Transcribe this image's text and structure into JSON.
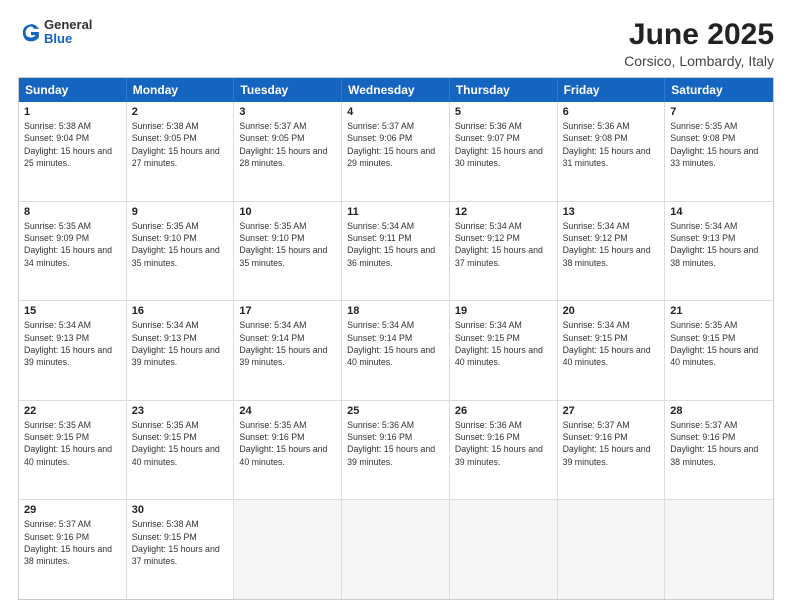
{
  "logo": {
    "general": "General",
    "blue": "Blue"
  },
  "title": "June 2025",
  "subtitle": "Corsico, Lombardy, Italy",
  "headers": [
    "Sunday",
    "Monday",
    "Tuesday",
    "Wednesday",
    "Thursday",
    "Friday",
    "Saturday"
  ],
  "rows": [
    [
      {
        "day": "1",
        "sunrise": "5:38 AM",
        "sunset": "9:04 PM",
        "daylight": "15 hours and 25 minutes."
      },
      {
        "day": "2",
        "sunrise": "5:38 AM",
        "sunset": "9:05 PM",
        "daylight": "15 hours and 27 minutes."
      },
      {
        "day": "3",
        "sunrise": "5:37 AM",
        "sunset": "9:05 PM",
        "daylight": "15 hours and 28 minutes."
      },
      {
        "day": "4",
        "sunrise": "5:37 AM",
        "sunset": "9:06 PM",
        "daylight": "15 hours and 29 minutes."
      },
      {
        "day": "5",
        "sunrise": "5:36 AM",
        "sunset": "9:07 PM",
        "daylight": "15 hours and 30 minutes."
      },
      {
        "day": "6",
        "sunrise": "5:36 AM",
        "sunset": "9:08 PM",
        "daylight": "15 hours and 31 minutes."
      },
      {
        "day": "7",
        "sunrise": "5:35 AM",
        "sunset": "9:08 PM",
        "daylight": "15 hours and 33 minutes."
      }
    ],
    [
      {
        "day": "8",
        "sunrise": "5:35 AM",
        "sunset": "9:09 PM",
        "daylight": "15 hours and 34 minutes."
      },
      {
        "day": "9",
        "sunrise": "5:35 AM",
        "sunset": "9:10 PM",
        "daylight": "15 hours and 35 minutes."
      },
      {
        "day": "10",
        "sunrise": "5:35 AM",
        "sunset": "9:10 PM",
        "daylight": "15 hours and 35 minutes."
      },
      {
        "day": "11",
        "sunrise": "5:34 AM",
        "sunset": "9:11 PM",
        "daylight": "15 hours and 36 minutes."
      },
      {
        "day": "12",
        "sunrise": "5:34 AM",
        "sunset": "9:12 PM",
        "daylight": "15 hours and 37 minutes."
      },
      {
        "day": "13",
        "sunrise": "5:34 AM",
        "sunset": "9:12 PM",
        "daylight": "15 hours and 38 minutes."
      },
      {
        "day": "14",
        "sunrise": "5:34 AM",
        "sunset": "9:13 PM",
        "daylight": "15 hours and 38 minutes."
      }
    ],
    [
      {
        "day": "15",
        "sunrise": "5:34 AM",
        "sunset": "9:13 PM",
        "daylight": "15 hours and 39 minutes."
      },
      {
        "day": "16",
        "sunrise": "5:34 AM",
        "sunset": "9:13 PM",
        "daylight": "15 hours and 39 minutes."
      },
      {
        "day": "17",
        "sunrise": "5:34 AM",
        "sunset": "9:14 PM",
        "daylight": "15 hours and 39 minutes."
      },
      {
        "day": "18",
        "sunrise": "5:34 AM",
        "sunset": "9:14 PM",
        "daylight": "15 hours and 40 minutes."
      },
      {
        "day": "19",
        "sunrise": "5:34 AM",
        "sunset": "9:15 PM",
        "daylight": "15 hours and 40 minutes."
      },
      {
        "day": "20",
        "sunrise": "5:34 AM",
        "sunset": "9:15 PM",
        "daylight": "15 hours and 40 minutes."
      },
      {
        "day": "21",
        "sunrise": "5:35 AM",
        "sunset": "9:15 PM",
        "daylight": "15 hours and 40 minutes."
      }
    ],
    [
      {
        "day": "22",
        "sunrise": "5:35 AM",
        "sunset": "9:15 PM",
        "daylight": "15 hours and 40 minutes."
      },
      {
        "day": "23",
        "sunrise": "5:35 AM",
        "sunset": "9:15 PM",
        "daylight": "15 hours and 40 minutes."
      },
      {
        "day": "24",
        "sunrise": "5:35 AM",
        "sunset": "9:16 PM",
        "daylight": "15 hours and 40 minutes."
      },
      {
        "day": "25",
        "sunrise": "5:36 AM",
        "sunset": "9:16 PM",
        "daylight": "15 hours and 39 minutes."
      },
      {
        "day": "26",
        "sunrise": "5:36 AM",
        "sunset": "9:16 PM",
        "daylight": "15 hours and 39 minutes."
      },
      {
        "day": "27",
        "sunrise": "5:37 AM",
        "sunset": "9:16 PM",
        "daylight": "15 hours and 39 minutes."
      },
      {
        "day": "28",
        "sunrise": "5:37 AM",
        "sunset": "9:16 PM",
        "daylight": "15 hours and 38 minutes."
      }
    ],
    [
      {
        "day": "29",
        "sunrise": "5:37 AM",
        "sunset": "9:16 PM",
        "daylight": "15 hours and 38 minutes."
      },
      {
        "day": "30",
        "sunrise": "5:38 AM",
        "sunset": "9:15 PM",
        "daylight": "15 hours and 37 minutes."
      },
      null,
      null,
      null,
      null,
      null
    ]
  ]
}
